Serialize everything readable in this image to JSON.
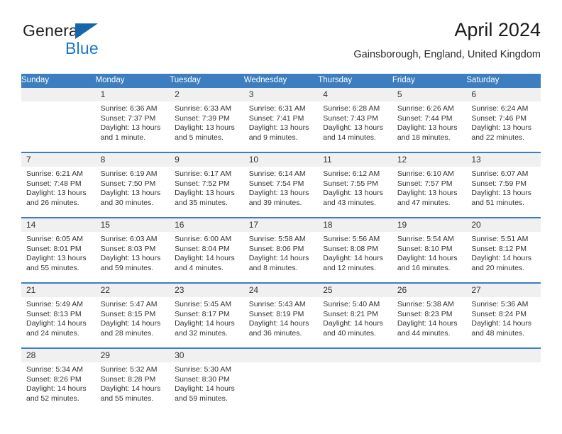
{
  "brand": {
    "name_part1": "General",
    "name_part2": "Blue",
    "triangle_color": "#1565a8",
    "blue_color": "#1878c8"
  },
  "header": {
    "title": "April 2024",
    "subtitle": "Gainsborough, England, United Kingdom"
  },
  "theme": {
    "header_row_bg": "#3c7ebf",
    "header_row_text": "#ffffff",
    "daynum_band_bg": "#f0f0f0",
    "cell_border": "#3c7ebf",
    "body_text": "#333333"
  },
  "weekdays": [
    "Sunday",
    "Monday",
    "Tuesday",
    "Wednesday",
    "Thursday",
    "Friday",
    "Saturday"
  ],
  "weeks": [
    [
      {
        "day": "",
        "sunrise": "",
        "sunset": "",
        "daylight1": "",
        "daylight2": ""
      },
      {
        "day": "1",
        "sunrise": "Sunrise: 6:36 AM",
        "sunset": "Sunset: 7:37 PM",
        "daylight1": "Daylight: 13 hours",
        "daylight2": "and 1 minute."
      },
      {
        "day": "2",
        "sunrise": "Sunrise: 6:33 AM",
        "sunset": "Sunset: 7:39 PM",
        "daylight1": "Daylight: 13 hours",
        "daylight2": "and 5 minutes."
      },
      {
        "day": "3",
        "sunrise": "Sunrise: 6:31 AM",
        "sunset": "Sunset: 7:41 PM",
        "daylight1": "Daylight: 13 hours",
        "daylight2": "and 9 minutes."
      },
      {
        "day": "4",
        "sunrise": "Sunrise: 6:28 AM",
        "sunset": "Sunset: 7:43 PM",
        "daylight1": "Daylight: 13 hours",
        "daylight2": "and 14 minutes."
      },
      {
        "day": "5",
        "sunrise": "Sunrise: 6:26 AM",
        "sunset": "Sunset: 7:44 PM",
        "daylight1": "Daylight: 13 hours",
        "daylight2": "and 18 minutes."
      },
      {
        "day": "6",
        "sunrise": "Sunrise: 6:24 AM",
        "sunset": "Sunset: 7:46 PM",
        "daylight1": "Daylight: 13 hours",
        "daylight2": "and 22 minutes."
      }
    ],
    [
      {
        "day": "7",
        "sunrise": "Sunrise: 6:21 AM",
        "sunset": "Sunset: 7:48 PM",
        "daylight1": "Daylight: 13 hours",
        "daylight2": "and 26 minutes."
      },
      {
        "day": "8",
        "sunrise": "Sunrise: 6:19 AM",
        "sunset": "Sunset: 7:50 PM",
        "daylight1": "Daylight: 13 hours",
        "daylight2": "and 30 minutes."
      },
      {
        "day": "9",
        "sunrise": "Sunrise: 6:17 AM",
        "sunset": "Sunset: 7:52 PM",
        "daylight1": "Daylight: 13 hours",
        "daylight2": "and 35 minutes."
      },
      {
        "day": "10",
        "sunrise": "Sunrise: 6:14 AM",
        "sunset": "Sunset: 7:54 PM",
        "daylight1": "Daylight: 13 hours",
        "daylight2": "and 39 minutes."
      },
      {
        "day": "11",
        "sunrise": "Sunrise: 6:12 AM",
        "sunset": "Sunset: 7:55 PM",
        "daylight1": "Daylight: 13 hours",
        "daylight2": "and 43 minutes."
      },
      {
        "day": "12",
        "sunrise": "Sunrise: 6:10 AM",
        "sunset": "Sunset: 7:57 PM",
        "daylight1": "Daylight: 13 hours",
        "daylight2": "and 47 minutes."
      },
      {
        "day": "13",
        "sunrise": "Sunrise: 6:07 AM",
        "sunset": "Sunset: 7:59 PM",
        "daylight1": "Daylight: 13 hours",
        "daylight2": "and 51 minutes."
      }
    ],
    [
      {
        "day": "14",
        "sunrise": "Sunrise: 6:05 AM",
        "sunset": "Sunset: 8:01 PM",
        "daylight1": "Daylight: 13 hours",
        "daylight2": "and 55 minutes."
      },
      {
        "day": "15",
        "sunrise": "Sunrise: 6:03 AM",
        "sunset": "Sunset: 8:03 PM",
        "daylight1": "Daylight: 13 hours",
        "daylight2": "and 59 minutes."
      },
      {
        "day": "16",
        "sunrise": "Sunrise: 6:00 AM",
        "sunset": "Sunset: 8:04 PM",
        "daylight1": "Daylight: 14 hours",
        "daylight2": "and 4 minutes."
      },
      {
        "day": "17",
        "sunrise": "Sunrise: 5:58 AM",
        "sunset": "Sunset: 8:06 PM",
        "daylight1": "Daylight: 14 hours",
        "daylight2": "and 8 minutes."
      },
      {
        "day": "18",
        "sunrise": "Sunrise: 5:56 AM",
        "sunset": "Sunset: 8:08 PM",
        "daylight1": "Daylight: 14 hours",
        "daylight2": "and 12 minutes."
      },
      {
        "day": "19",
        "sunrise": "Sunrise: 5:54 AM",
        "sunset": "Sunset: 8:10 PM",
        "daylight1": "Daylight: 14 hours",
        "daylight2": "and 16 minutes."
      },
      {
        "day": "20",
        "sunrise": "Sunrise: 5:51 AM",
        "sunset": "Sunset: 8:12 PM",
        "daylight1": "Daylight: 14 hours",
        "daylight2": "and 20 minutes."
      }
    ],
    [
      {
        "day": "21",
        "sunrise": "Sunrise: 5:49 AM",
        "sunset": "Sunset: 8:13 PM",
        "daylight1": "Daylight: 14 hours",
        "daylight2": "and 24 minutes."
      },
      {
        "day": "22",
        "sunrise": "Sunrise: 5:47 AM",
        "sunset": "Sunset: 8:15 PM",
        "daylight1": "Daylight: 14 hours",
        "daylight2": "and 28 minutes."
      },
      {
        "day": "23",
        "sunrise": "Sunrise: 5:45 AM",
        "sunset": "Sunset: 8:17 PM",
        "daylight1": "Daylight: 14 hours",
        "daylight2": "and 32 minutes."
      },
      {
        "day": "24",
        "sunrise": "Sunrise: 5:43 AM",
        "sunset": "Sunset: 8:19 PM",
        "daylight1": "Daylight: 14 hours",
        "daylight2": "and 36 minutes."
      },
      {
        "day": "25",
        "sunrise": "Sunrise: 5:40 AM",
        "sunset": "Sunset: 8:21 PM",
        "daylight1": "Daylight: 14 hours",
        "daylight2": "and 40 minutes."
      },
      {
        "day": "26",
        "sunrise": "Sunrise: 5:38 AM",
        "sunset": "Sunset: 8:23 PM",
        "daylight1": "Daylight: 14 hours",
        "daylight2": "and 44 minutes."
      },
      {
        "day": "27",
        "sunrise": "Sunrise: 5:36 AM",
        "sunset": "Sunset: 8:24 PM",
        "daylight1": "Daylight: 14 hours",
        "daylight2": "and 48 minutes."
      }
    ],
    [
      {
        "day": "28",
        "sunrise": "Sunrise: 5:34 AM",
        "sunset": "Sunset: 8:26 PM",
        "daylight1": "Daylight: 14 hours",
        "daylight2": "and 52 minutes."
      },
      {
        "day": "29",
        "sunrise": "Sunrise: 5:32 AM",
        "sunset": "Sunset: 8:28 PM",
        "daylight1": "Daylight: 14 hours",
        "daylight2": "and 55 minutes."
      },
      {
        "day": "30",
        "sunrise": "Sunrise: 5:30 AM",
        "sunset": "Sunset: 8:30 PM",
        "daylight1": "Daylight: 14 hours",
        "daylight2": "and 59 minutes."
      },
      {
        "day": "",
        "sunrise": "",
        "sunset": "",
        "daylight1": "",
        "daylight2": ""
      },
      {
        "day": "",
        "sunrise": "",
        "sunset": "",
        "daylight1": "",
        "daylight2": ""
      },
      {
        "day": "",
        "sunrise": "",
        "sunset": "",
        "daylight1": "",
        "daylight2": ""
      },
      {
        "day": "",
        "sunrise": "",
        "sunset": "",
        "daylight1": "",
        "daylight2": ""
      }
    ]
  ]
}
